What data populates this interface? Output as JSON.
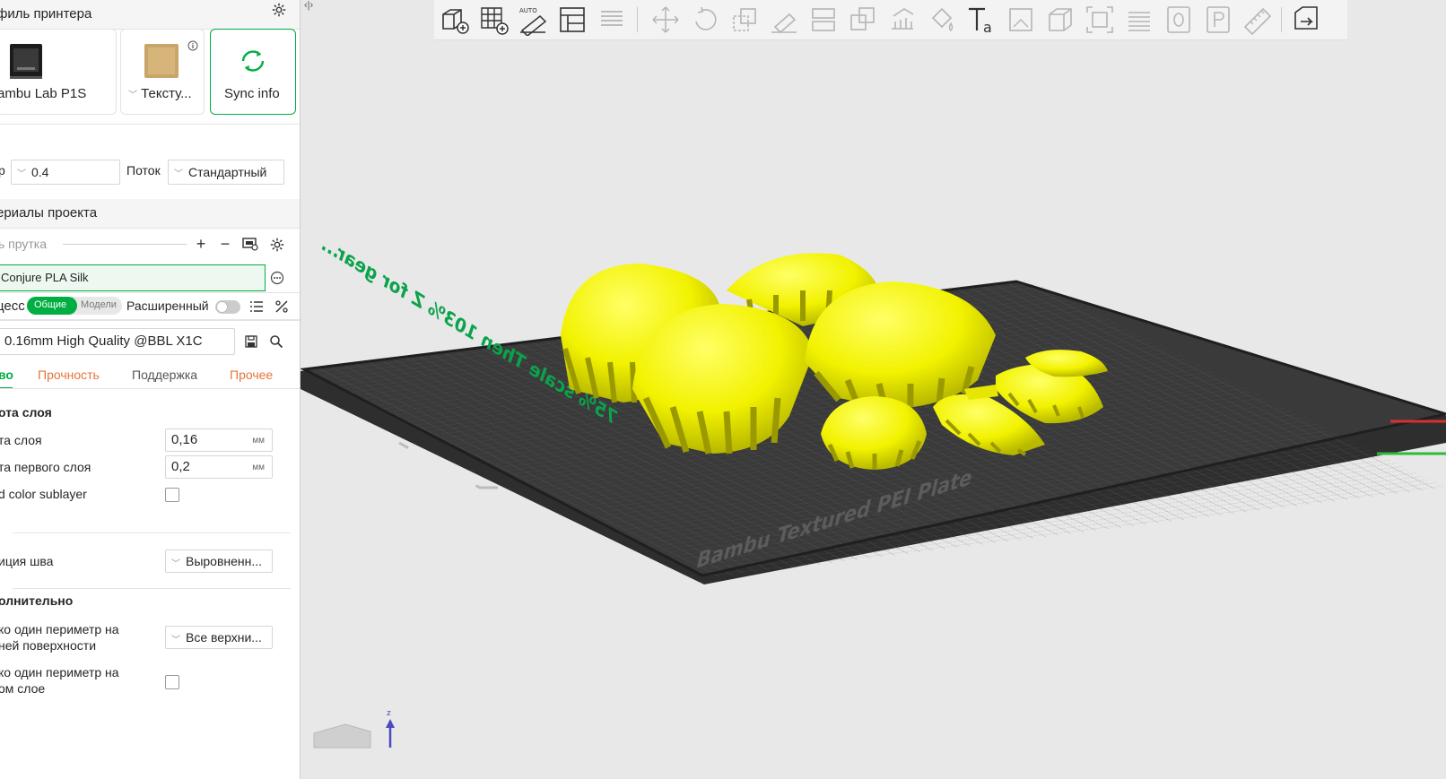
{
  "printer_profile": {
    "title": "филь принтера",
    "printer_name": "ambu Lab P1S",
    "plate_name": "Тексту...",
    "sync_label": "Sync info"
  },
  "nozzle": {
    "label": "р",
    "value": "0.4",
    "flow_label": "Поток",
    "flow_value": "Стандартный"
  },
  "materials": {
    "title": "ериалы проекта",
    "filament_label": "ь прутка",
    "filament_name": "Conjure PLA Silk"
  },
  "process": {
    "label": "цесс",
    "toggle_general": "Общие",
    "toggle_models": "Модели",
    "advanced_label": "Расширенный",
    "preset_name": "0.16mm High Quality @BBL X1C"
  },
  "tabs": {
    "quality": "во",
    "strength": "Прочность",
    "support": "Поддержка",
    "others": "Прочее"
  },
  "settings": {
    "layer_group": "ота слоя",
    "layer_height_label": "та слоя",
    "layer_height_value": "0,16",
    "first_layer_label": "та первого слоя",
    "first_layer_value": "0,2",
    "unit": "мм",
    "sublayer_label": "d color sublayer",
    "seam_label": "иция шва",
    "seam_value": "Выровненн...",
    "extra_group": "олнительно",
    "one_wall_top_label_1": "ко один периметр на",
    "one_wall_top_label_2": "ней поверхности",
    "one_wall_top_value": "Все верхни...",
    "one_wall_first_label_1": "ко один периметр на",
    "one_wall_first_label_2": "ом слое"
  },
  "viewport": {
    "plate_text": "Bambu Textured PEI Plate",
    "plate_annotation": "75% scale Then 103% Z for gear..."
  },
  "colors": {
    "accent": "#00ae42",
    "orange": "#e8743b",
    "model": "#ffff00",
    "plate": "#3a3a3a"
  }
}
